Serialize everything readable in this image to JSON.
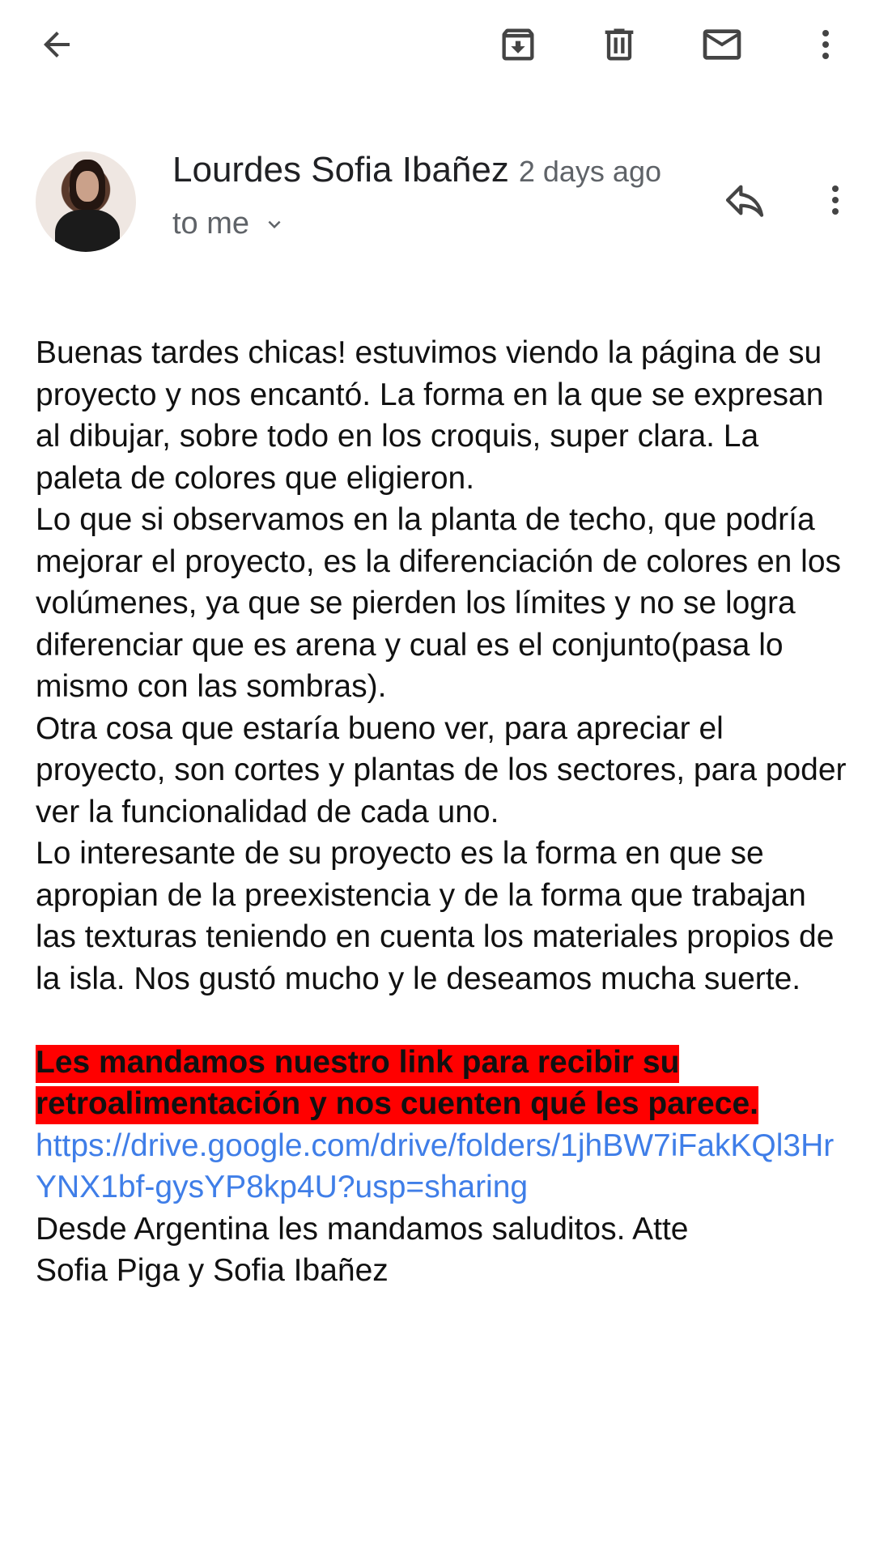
{
  "toolbar": {
    "back_icon": "arrow-back-icon",
    "archive_icon": "archive-icon",
    "delete_icon": "trash-icon",
    "mark_unread_icon": "mail-icon",
    "more_icon": "more-vert-icon"
  },
  "message": {
    "sender_name": "Lourdes Sofia Ibañez",
    "time": "2 days ago",
    "recipient": "to me",
    "avatar_icon": "avatar",
    "reply_icon": "reply-icon",
    "more_icon": "more-vert-icon",
    "paragraphs": [
      "Buenas tardes chicas! estuvimos viendo la página de su proyecto y nos encantó. La forma en la que se expresan al dibujar, sobre todo en los croquis, super clara. La paleta de colores que eligieron.",
      "Lo que si observamos en la planta de techo, que podría mejorar el proyecto, es la diferenciación de colores en los volúmenes, ya que se pierden los límites y no se logra diferenciar que es arena y cual es el conjunto(pasa lo mismo con las sombras).",
      "Otra cosa que estaría bueno ver, para apreciar el proyecto, son cortes y plantas de los sectores, para poder ver la funcionalidad de cada uno.",
      "Lo interesante de su proyecto es la forma en que se apropian de la preexistencia y de la forma que trabajan las texturas teniendo en cuenta los materiales propios de la isla. Nos gustó mucho y le deseamos mucha suerte."
    ],
    "highlight_text": "Les mandamos nuestro link para recibir su retroalimentación y nos cuenten qué les parece.",
    "highlight_color": "#ff0000",
    "link": "https://drive.google.com/drive/folders/1jhBW7iFakKQl3HrYNX1bf-gysYP8kp4U?usp=sharing",
    "link_color": "#3f7ee8",
    "signature_line1": "Desde Argentina les mandamos saluditos. Atte",
    "signature_line2": "Sofia Piga y Sofia Ibañez"
  }
}
